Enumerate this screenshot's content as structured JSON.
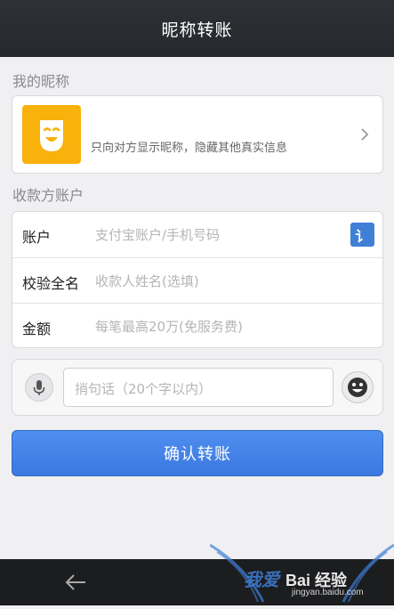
{
  "header": {
    "title": "昵称转账"
  },
  "nickname_section": {
    "label": "我的昵称",
    "hint": "只向对方显示昵称，隐藏其他真实信息",
    "nickname_value": ""
  },
  "account_section": {
    "label": "收款方账户",
    "rows": [
      {
        "label": "账户",
        "placeholder": "支付宝账户/手机号码"
      },
      {
        "label": "校验全名",
        "placeholder": "收款人姓名(选填)"
      },
      {
        "label": "金额",
        "placeholder": "每笔最高20万(免服务费)"
      }
    ],
    "contact_icon_glyph": "讠"
  },
  "message": {
    "placeholder": "捎句话（20个字以内）"
  },
  "confirm_button": {
    "label": "确认转账"
  },
  "watermark": {
    "cn": "我爱",
    "brand": "Bai 经验",
    "url": "jingyan.baidu.com"
  },
  "colors": {
    "accent": "#3f7fd6",
    "avatar": "#f9b10b",
    "titlebar": "#2a2d32"
  },
  "icons": [
    "mask-avatar-icon",
    "chevron-right-icon",
    "contacts-icon",
    "microphone-icon",
    "emoji-icon",
    "back-arrow-icon"
  ]
}
